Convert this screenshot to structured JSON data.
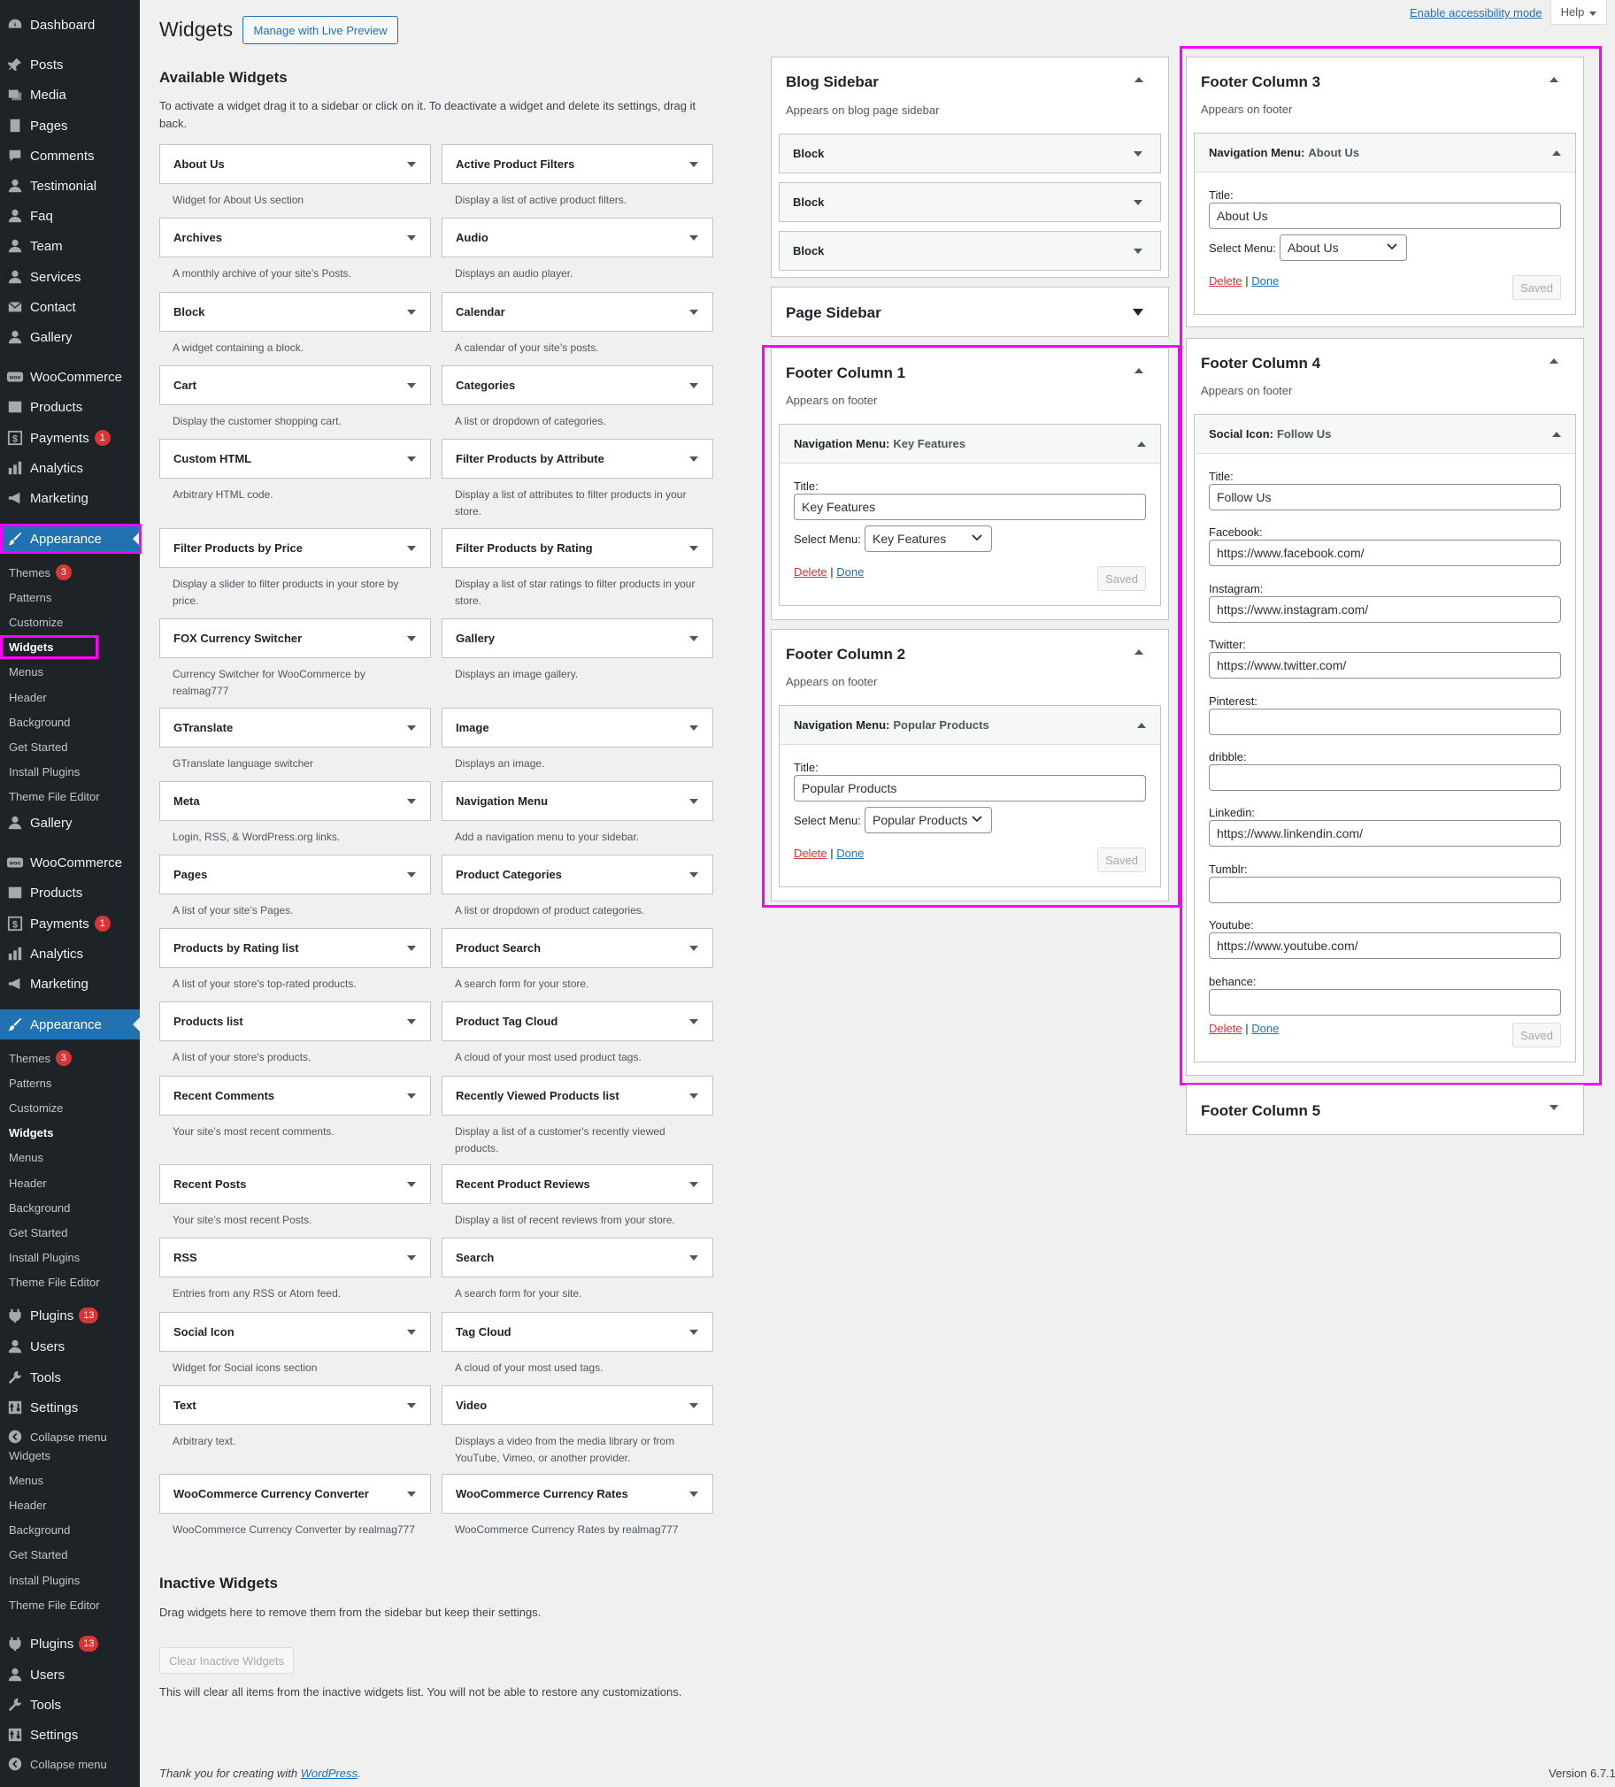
{
  "sidebar": {
    "top_items": [
      "Dashboard",
      "Posts",
      "Media",
      "Pages",
      "Comments",
      "Testimonial",
      "Faq",
      "Team",
      "Services",
      "Contact",
      "Gallery",
      "WooCommerce",
      "Products",
      "Payments",
      "Analytics",
      "Marketing",
      "Appearance"
    ],
    "sub1": [
      "Themes",
      "Patterns",
      "Customize",
      "Widgets",
      "Menus",
      "Header",
      "Background",
      "Get Started",
      "Install Plugins",
      "Theme File Editor"
    ],
    "mid_items": [
      "Gallery",
      "WooCommerce",
      "Products",
      "Payments",
      "Analytics",
      "Marketing",
      "Appearance"
    ],
    "sub2": [
      "Themes",
      "Patterns",
      "Customize",
      "Widgets",
      "Menus",
      "Header",
      "Background",
      "Get Started",
      "Install Plugins",
      "Theme File Editor"
    ],
    "bottom_items": [
      "Plugins",
      "Users",
      "Tools",
      "Settings",
      "Collapse menu"
    ],
    "sub3": [
      "Widgets",
      "Menus",
      "Header",
      "Background",
      "Get Started",
      "Install Plugins",
      "Theme File Editor"
    ],
    "bottom2_items": [
      "Plugins",
      "Users",
      "Tools",
      "Settings",
      "Collapse menu"
    ],
    "badges": {
      "payments": "1",
      "themes": "3",
      "plugins": "13"
    }
  },
  "header": {
    "title": "Widgets",
    "live_preview": "Manage with Live Preview",
    "accessibility": "Enable accessibility mode",
    "help": "Help"
  },
  "available": {
    "heading": "Available Widgets",
    "desc": "To activate a widget drag it to a sidebar or click on it. To deactivate a widget and delete its settings, drag it back.",
    "widgets": [
      {
        "name": "About Us",
        "desc": "Widget for About Us section"
      },
      {
        "name": "Active Product Filters",
        "desc": "Display a list of active product filters."
      },
      {
        "name": "Archives",
        "desc": "A monthly archive of your site’s Posts."
      },
      {
        "name": "Audio",
        "desc": "Displays an audio player."
      },
      {
        "name": "Block",
        "desc": "A widget containing a block."
      },
      {
        "name": "Calendar",
        "desc": "A calendar of your site’s posts."
      },
      {
        "name": "Cart",
        "desc": "Display the customer shopping cart."
      },
      {
        "name": "Categories",
        "desc": "A list or dropdown of categories."
      },
      {
        "name": "Custom HTML",
        "desc": "Arbitrary HTML code."
      },
      {
        "name": "Filter Products by Attribute",
        "desc": "Display a list of attributes to filter products in your store."
      },
      {
        "name": "Filter Products by Price",
        "desc": "Display a slider to filter products in your store by price."
      },
      {
        "name": "Filter Products by Rating",
        "desc": "Display a list of star ratings to filter products in your store."
      },
      {
        "name": "FOX Currency Switcher",
        "desc": "Currency Switcher for WooCommerce by realmag777"
      },
      {
        "name": "Gallery",
        "desc": "Displays an image gallery."
      },
      {
        "name": "GTranslate",
        "desc": "GTranslate language switcher"
      },
      {
        "name": "Image",
        "desc": "Displays an image."
      },
      {
        "name": "Meta",
        "desc": "Login, RSS, & WordPress.org links."
      },
      {
        "name": "Navigation Menu",
        "desc": "Add a navigation menu to your sidebar."
      },
      {
        "name": "Pages",
        "desc": "A list of your site’s Pages."
      },
      {
        "name": "Product Categories",
        "desc": "A list or dropdown of product categories."
      },
      {
        "name": "Products by Rating list",
        "desc": "A list of your store's top-rated products."
      },
      {
        "name": "Product Search",
        "desc": "A search form for your store."
      },
      {
        "name": "Products list",
        "desc": "A list of your store's products."
      },
      {
        "name": "Product Tag Cloud",
        "desc": "A cloud of your most used product tags."
      },
      {
        "name": "Recent Comments",
        "desc": "Your site’s most recent comments."
      },
      {
        "name": "Recently Viewed Products list",
        "desc": "Display a list of a customer's recently viewed products."
      },
      {
        "name": "Recent Posts",
        "desc": "Your site’s most recent Posts."
      },
      {
        "name": "Recent Product Reviews",
        "desc": "Display a list of recent reviews from your store."
      },
      {
        "name": "RSS",
        "desc": "Entries from any RSS or Atom feed."
      },
      {
        "name": "Search",
        "desc": "A search form for your site."
      },
      {
        "name": "Social Icon",
        "desc": "Widget for Social icons section"
      },
      {
        "name": "Tag Cloud",
        "desc": "A cloud of your most used tags."
      },
      {
        "name": "Text",
        "desc": "Arbitrary text."
      },
      {
        "name": "Video",
        "desc": "Displays a video from the media library or from YouTube, Vimeo, or another provider."
      },
      {
        "name": "WooCommerce Currency Converter",
        "desc": "WooCommerce Currency Converter by realmag777"
      },
      {
        "name": "WooCommerce Currency Rates",
        "desc": "WooCommerce Currency Rates by realmag777"
      }
    ]
  },
  "inactive": {
    "heading": "Inactive Widgets",
    "desc": "Drag widgets here to remove them from the sidebar but keep their settings.",
    "button": "Clear Inactive Widgets",
    "note": "This will clear all items from the inactive widgets list. You will not be able to restore any customizations."
  },
  "footer": {
    "thanks": "Thank you for creating with ",
    "wp": "WordPress",
    "period": ".",
    "version": "Version 6.7.1"
  },
  "blog_sidebar": {
    "title": "Blog Sidebar",
    "desc": "Appears on blog page sidebar",
    "blocks": [
      "Block",
      "Block",
      "Block"
    ]
  },
  "page_sidebar": {
    "title": "Page Sidebar"
  },
  "fc1": {
    "title": "Footer Column 1",
    "desc": "Appears on footer",
    "widget": "Navigation Menu:",
    "widget_sub": "Key Features",
    "title_label": "Title:",
    "title_value": "Key Features",
    "menu_label": "Select Menu:",
    "menu_value": "Key Features"
  },
  "fc2": {
    "title": "Footer Column 2",
    "desc": "Appears on footer",
    "widget": "Navigation Menu:",
    "widget_sub": "Popular Products",
    "title_label": "Title:",
    "title_value": "Popular Products",
    "menu_label": "Select Menu:",
    "menu_value": "Popular Products"
  },
  "fc3": {
    "title": "Footer Column 3",
    "desc": "Appears on footer",
    "widget": "Navigation Menu:",
    "widget_sub": "About Us",
    "title_label": "Title:",
    "title_value": "About Us",
    "menu_label": "Select Menu:",
    "menu_value": "About Us"
  },
  "fc4": {
    "title": "Footer Column 4",
    "desc": "Appears on footer",
    "widget": "Social Icon:",
    "widget_sub": "Follow Us",
    "fields": [
      {
        "label": "Title:",
        "value": "Follow Us"
      },
      {
        "label": "Facebook:",
        "value": "https://www.facebook.com/"
      },
      {
        "label": "Instagram:",
        "value": "https://www.instagram.com/"
      },
      {
        "label": "Twitter:",
        "value": "https://www.twitter.com/"
      },
      {
        "label": "Pinterest:",
        "value": ""
      },
      {
        "label": "dribble:",
        "value": ""
      },
      {
        "label": "Linkedin:",
        "value": "https://www.linkendin.com/"
      },
      {
        "label": "Tumblr:",
        "value": ""
      },
      {
        "label": "Youtube:",
        "value": "https://www.youtube.com/"
      },
      {
        "label": "behance:",
        "value": ""
      }
    ]
  },
  "fc5": {
    "title": "Footer Column 5"
  },
  "actions": {
    "delete": "Delete",
    "sep": "|",
    "done": "Done",
    "saved": "Saved"
  },
  "colors": {
    "sidebar_bg": "#1d2327",
    "accent": "#2271b1",
    "highlight": "#ff00ff",
    "badge": "#d63638",
    "link": "#2271b1",
    "delete": "#d63638"
  }
}
